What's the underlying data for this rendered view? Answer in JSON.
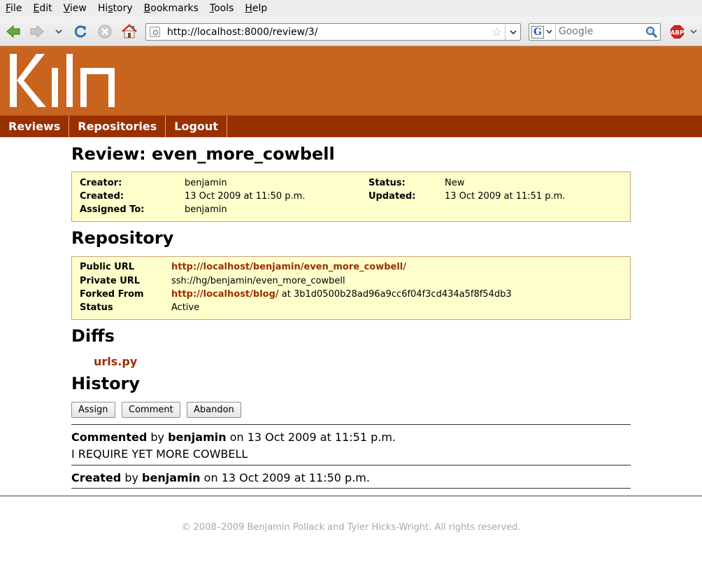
{
  "browser": {
    "menu": [
      "File",
      "Edit",
      "View",
      "History",
      "Bookmarks",
      "Tools",
      "Help"
    ],
    "menu_underline": [
      "F",
      "E",
      "V",
      "s",
      "B",
      "T",
      "H"
    ],
    "url": "http://localhost:8000/review/3/",
    "search_placeholder": "Google"
  },
  "nav": {
    "items": [
      "Reviews",
      "Repositories",
      "Logout"
    ]
  },
  "review": {
    "title": "Review: even_more_cowbell",
    "labels": {
      "creator": "Creator:",
      "created": "Created:",
      "assigned": "Assigned To:",
      "status": "Status:",
      "updated": "Updated:"
    },
    "creator": "benjamin",
    "created": "13 Oct 2009 at 11:50 p.m.",
    "assigned_to": "benjamin",
    "status": "New",
    "updated": "13 Oct 2009 at 11:51 p.m."
  },
  "repository": {
    "heading": "Repository",
    "labels": {
      "public_url": "Public URL",
      "private_url": "Private URL",
      "forked_from": "Forked From",
      "status": "Status"
    },
    "public_url": "http://localhost/benjamin/even_more_cowbell/",
    "private_url": "ssh://hg/benjamin/even_more_cowbell",
    "forked_from_url": "http://localhost/blog/",
    "forked_from_suffix": "at 3b1d0500b28ad96a9cc6f04f3cd434a5f8f54db3",
    "status": "Active"
  },
  "diffs": {
    "heading": "Diffs",
    "files": [
      "urls.py"
    ]
  },
  "history": {
    "heading": "History",
    "buttons": [
      "Assign",
      "Comment",
      "Abandon"
    ],
    "entries": [
      {
        "action": "Commented",
        "by": "by",
        "user": "benjamin",
        "on": "on 13 Oct 2009 at 11:51 p.m.",
        "comment": "I REQUIRE YET MORE COWBELL"
      },
      {
        "action": "Created",
        "by": "by",
        "user": "benjamin",
        "on": "on 13 Oct 2009 at 11:50 p.m."
      }
    ]
  },
  "footer": {
    "text": "© 2008–2009 Benjamin Pollack and Tyler Hicks-Wright. All rights reserved."
  },
  "colors": {
    "header": "#c9641f",
    "nav": "#993000",
    "link": "#993000",
    "info_box": "#ffffcc"
  }
}
